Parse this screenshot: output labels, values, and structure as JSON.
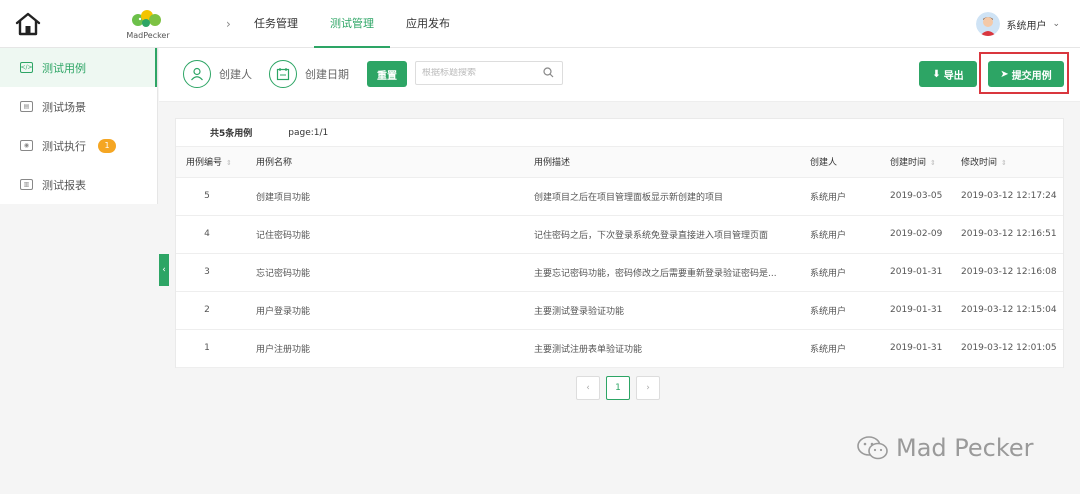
{
  "app": {
    "logo_text": "MadPecker"
  },
  "nav": {
    "items": [
      {
        "label": "任务管理"
      },
      {
        "label": "测试管理"
      },
      {
        "label": "应用发布"
      }
    ]
  },
  "user": {
    "name": "系统用户"
  },
  "sidebar": {
    "items": [
      {
        "label": "测试用例"
      },
      {
        "label": "测试场景"
      },
      {
        "label": "测试执行",
        "badge": "1"
      },
      {
        "label": "测试报表"
      }
    ]
  },
  "filters": {
    "creator_label": "创建人",
    "date_label": "创建日期",
    "reset_label": "重置",
    "search_placeholder": "根据标题搜索"
  },
  "actions": {
    "export_label": "导出",
    "submit_label": "提交用例"
  },
  "table": {
    "total_text": "共5条用例",
    "page_text": "page:1/1",
    "headers": {
      "num": "用例编号",
      "name": "用例名称",
      "desc": "用例描述",
      "creator": "创建人",
      "created": "创建时间",
      "modified": "修改时间"
    },
    "rows": [
      {
        "num": "5",
        "name": "创建项目功能",
        "desc": "创建项目之后在项目管理面板显示新创建的项目",
        "creator": "系统用户",
        "created": "2019-03-05",
        "modified": "2019-03-12 12:17:24"
      },
      {
        "num": "4",
        "name": "记住密码功能",
        "desc": "记住密码之后，下次登录系统免登录直接进入项目管理页面",
        "creator": "系统用户",
        "created": "2019-02-09",
        "modified": "2019-03-12 12:16:51"
      },
      {
        "num": "3",
        "name": "忘记密码功能",
        "desc": "主要忘记密码功能，密码修改之后需要重新登录验证密码是...",
        "creator": "系统用户",
        "created": "2019-01-31",
        "modified": "2019-03-12 12:16:08"
      },
      {
        "num": "2",
        "name": "用户登录功能",
        "desc": "主要测试登录验证功能",
        "creator": "系统用户",
        "created": "2019-01-31",
        "modified": "2019-03-12 12:15:04"
      },
      {
        "num": "1",
        "name": "用户注册功能",
        "desc": "主要测试注册表单验证功能",
        "creator": "系统用户",
        "created": "2019-01-31",
        "modified": "2019-03-12 12:01:05"
      }
    ]
  },
  "pagination": {
    "prev": "‹",
    "current": "1",
    "next": "›"
  },
  "watermark": {
    "text": "Mad Pecker"
  },
  "colors": {
    "accent": "#2da565",
    "badge": "#f5a623",
    "highlight": "#d9363e"
  }
}
